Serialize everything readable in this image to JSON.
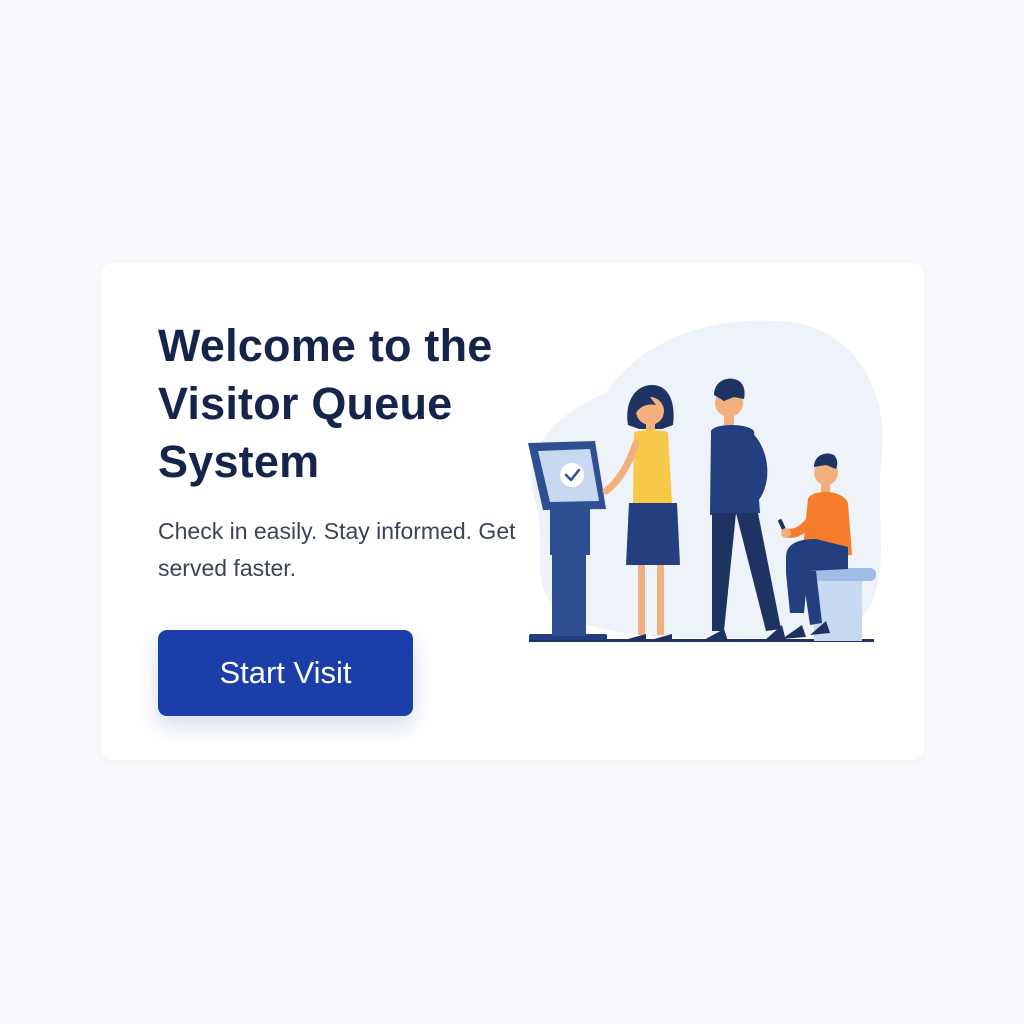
{
  "welcome": {
    "title": "Welcome to the Visitor Queue System",
    "subtitle": "Check in easily. Stay informed. Get served faster.",
    "start_button_label": "Start Visit"
  },
  "illustration": {
    "icon": "queue-kiosk-illustration",
    "kiosk_icon": "check-circle-icon"
  },
  "colors": {
    "background": "#f8fafd",
    "card": "#ffffff",
    "title": "#14244a",
    "button": "#1b3ea8",
    "kiosk": "#2f4f93",
    "accent_yellow": "#f7c948",
    "accent_orange": "#f47c2a"
  }
}
